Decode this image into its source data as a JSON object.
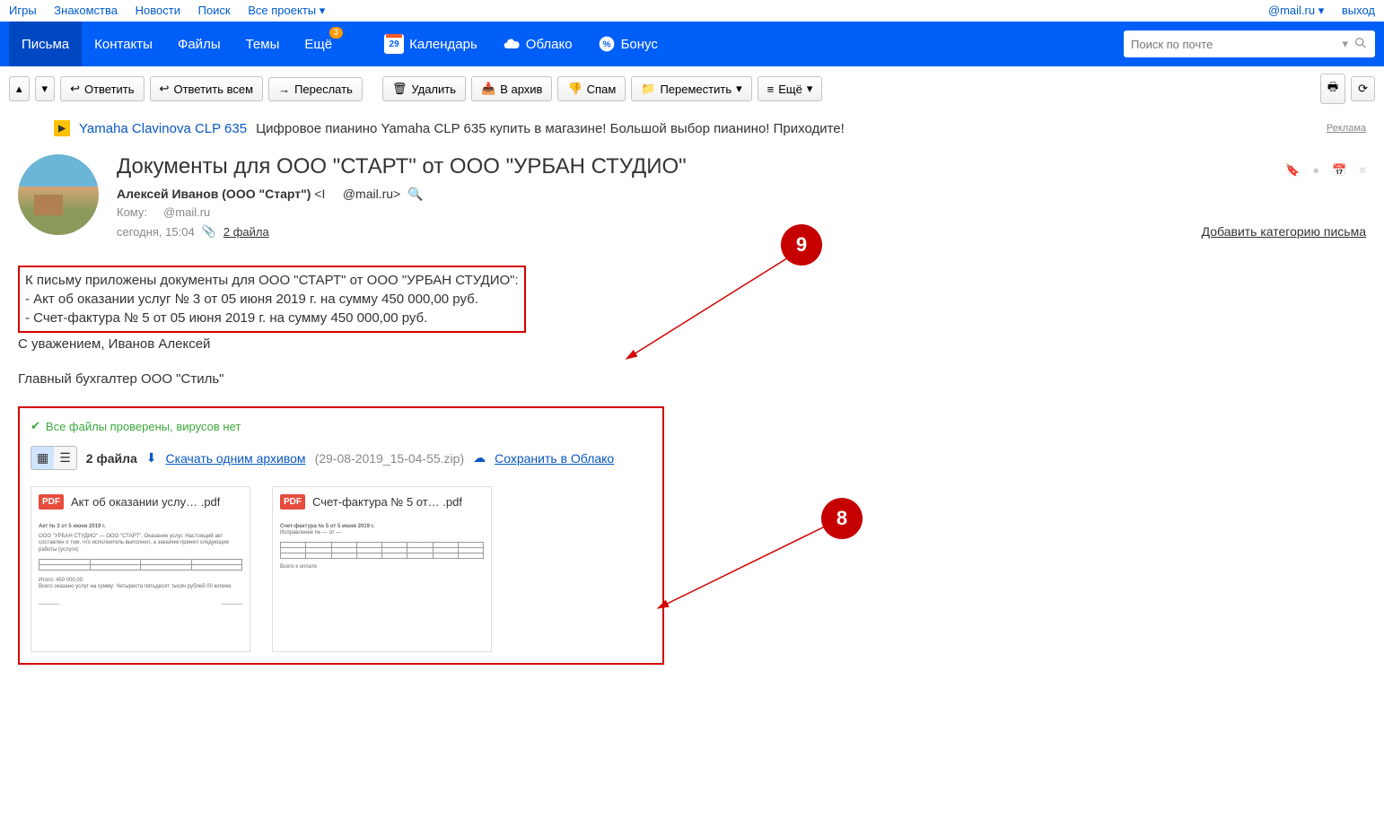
{
  "topbar": {
    "left": [
      "Игры",
      "Знакомства",
      "Новости",
      "Поиск",
      "Все проекты"
    ],
    "account": "@mail.ru",
    "logout": "выход"
  },
  "nav": {
    "mail": "Письма",
    "contacts": "Контакты",
    "files": "Файлы",
    "themes": "Темы",
    "more": "Ещё",
    "more_badge": "3",
    "calendar": "Календарь",
    "calendar_day": "29",
    "cloud": "Облако",
    "bonus": "Бонус",
    "search_placeholder": "Поиск по почте"
  },
  "toolbar": {
    "reply": "Ответить",
    "reply_all": "Ответить всем",
    "forward": "Переслать",
    "delete": "Удалить",
    "archive": "В архив",
    "spam": "Спам",
    "move": "Переместить",
    "more": "Ещё"
  },
  "ad": {
    "link": "Yamaha Clavinova CLP 635",
    "text": "Цифровое пианино Yamaha CLP 635 купить в магазине! Большой выбор пианино! Приходите!",
    "label": "Реклама"
  },
  "email": {
    "subject": "Документы для ООО \"СТАРТ\" от ООО \"УРБАН СТУДИО\"",
    "from_name": "Алексей Иванов (ООО \"Старт\")",
    "from_email_prefix": "<I",
    "from_email_suffix": "@mail.ru>",
    "to_label": "Кому:",
    "to_value": "@mail.ru",
    "date": "сегодня, 15:04",
    "attach_count": "2 файла",
    "add_category": "Добавить категорию письма",
    "body_line1": "К письму приложены документы для ООО \"СТАРТ\" от ООО \"УРБАН СТУДИО\":",
    "body_line2": "- Акт об оказании услуг № 3 от 05 июня 2019 г. на сумму 450 000,00 руб.",
    "body_line3": "- Счет-фактура № 5 от 05 июня 2019 г. на сумму 450 000,00 руб.",
    "signature1": "С уважением, Иванов Алексей",
    "signature2": "Главный бухгалтер ООО \"Стиль\""
  },
  "attachments": {
    "virus_ok": "Все файлы проверены, вирусов нет",
    "count": "2 файла",
    "download_all": "Скачать одним архивом",
    "archive_name": "(29-08-2019_15-04-55.zip)",
    "save_cloud": "Сохранить в Облако",
    "files": [
      {
        "name": "Акт об оказании услу… .pdf",
        "badge": "PDF"
      },
      {
        "name": "Счет-фактура № 5 от… .pdf",
        "badge": "PDF"
      }
    ]
  },
  "callouts": {
    "c9": "9",
    "c8": "8"
  }
}
